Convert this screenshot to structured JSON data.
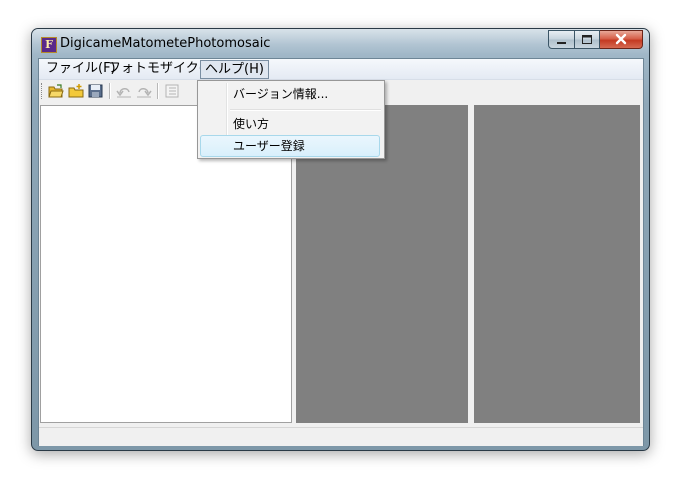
{
  "window": {
    "title": "DigicameMatometePhotomosaic",
    "app_icon_letter": "F",
    "buttons": {
      "minimize": "–",
      "maximize": "□",
      "close": "X"
    }
  },
  "menubar": {
    "items": [
      {
        "label": "ファイル(F)"
      },
      {
        "label": "フォトモザイク(M)"
      },
      {
        "label": "ヘルプ(H)"
      }
    ]
  },
  "toolbar": {
    "buttons": [
      {
        "icon": "open-folder-icon"
      },
      {
        "icon": "new-folder-icon"
      },
      {
        "icon": "save-icon"
      },
      {
        "icon": "undo-icon"
      },
      {
        "icon": "redo-icon"
      },
      {
        "icon": "properties-icon"
      }
    ]
  },
  "help_menu": {
    "items": [
      {
        "label": "バージョン情報..."
      },
      {
        "label": "使い方"
      },
      {
        "label": "ユーザー登録"
      }
    ]
  },
  "colors": {
    "pane_gray": "#808080",
    "highlight": "#d9f0fc"
  }
}
